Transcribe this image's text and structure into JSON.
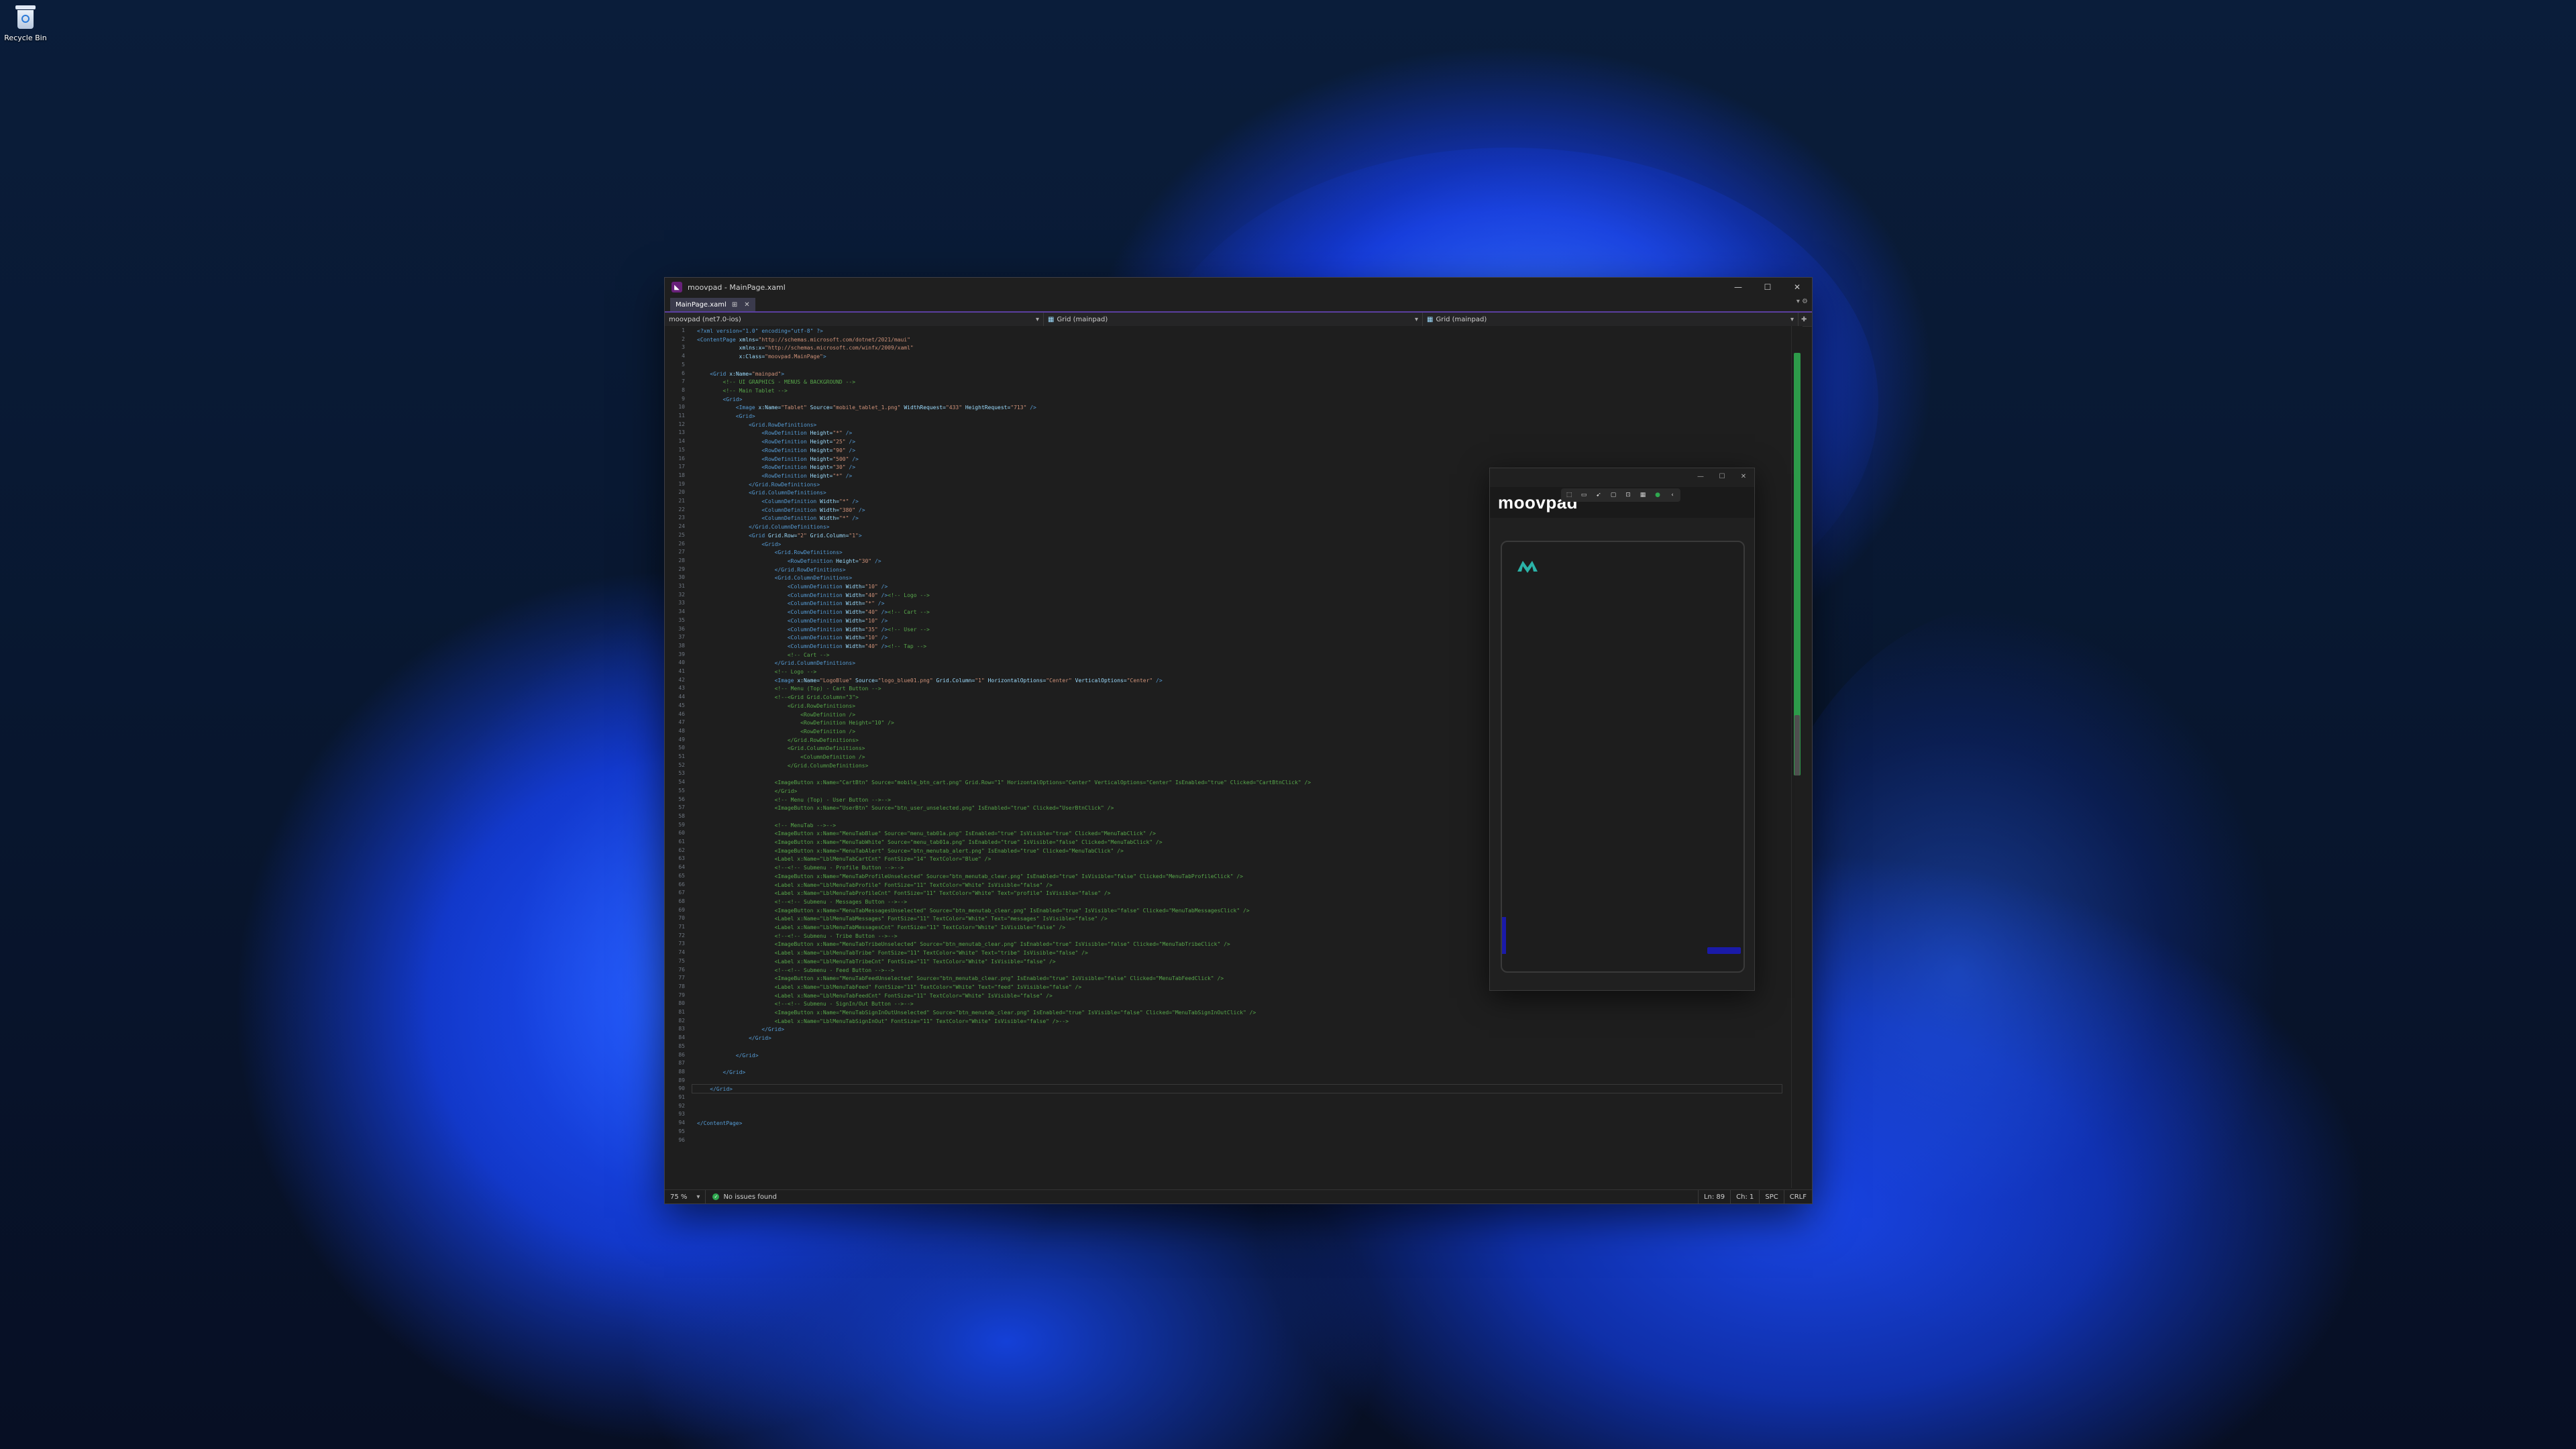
{
  "desktop": {
    "recycle_bin_label": "Recycle Bin"
  },
  "window": {
    "title": "moovpad - MainPage.xaml",
    "controls": [
      "—",
      "☐",
      "✕"
    ]
  },
  "tab": {
    "label": "MainPage.xaml",
    "pin": "⊞",
    "close": "✕"
  },
  "navbar": {
    "project": "moovpad (net7.0-ios)",
    "scope1": "Grid (mainpad)",
    "scope2": "Grid (mainpad)"
  },
  "code_lines": [
    {
      "n": "1",
      "html": "<span class='t-tag'>&lt;?xml version=\"1.0\" encoding=\"utf-8\" ?&gt;</span>"
    },
    {
      "n": "2",
      "html": "<span class='t-tag'>&lt;ContentPage</span> <span class='t-attr'>xmlns=</span><span class='t-val'>\"http://schemas.microsoft.com/dotnet/2021/maui\"</span>"
    },
    {
      "n": "3",
      "html": "             <span class='t-attr'>xmlns:x=</span><span class='t-val'>\"http://schemas.microsoft.com/winfx/2009/xaml\"</span>"
    },
    {
      "n": "4",
      "html": "             <span class='t-attr'>x:Class=</span><span class='t-val'>\"moovpad.MainPage\"</span><span class='t-tag'>&gt;</span>"
    },
    {
      "n": "5",
      "html": ""
    },
    {
      "n": "6",
      "html": "    <span class='t-tag'>&lt;Grid</span> <span class='t-attr'>x:Name=</span><span class='t-val'>\"mainpad\"</span><span class='t-tag'>&gt;</span>"
    },
    {
      "n": "7",
      "html": "        <span class='t-com'>&lt;!-- UI GRAPHICS - MENUS &amp; BACKGROUND --&gt;</span>"
    },
    {
      "n": "8",
      "html": "        <span class='t-com'>&lt;!-- Main Tablet --&gt;</span>"
    },
    {
      "n": "9",
      "html": "        <span class='t-tag'>&lt;Grid&gt;</span>"
    },
    {
      "n": "10",
      "html": "            <span class='t-tag'>&lt;Image</span> <span class='t-attr'>x:Name=</span><span class='t-val'>\"Tablet\"</span> <span class='t-attr'>Source=</span><span class='t-val'>\"mobile_tablet_1.png\"</span> <span class='t-attr'>WidthRequest=</span><span class='t-val'>\"433\"</span> <span class='t-attr'>HeightRequest=</span><span class='t-val'>\"713\"</span> <span class='t-tag'>/&gt;</span>"
    },
    {
      "n": "11",
      "html": "            <span class='t-tag'>&lt;Grid&gt;</span>"
    },
    {
      "n": "12",
      "html": "                <span class='t-tag'>&lt;Grid.RowDefinitions&gt;</span>"
    },
    {
      "n": "13",
      "html": "                    <span class='t-tag'>&lt;RowDefinition</span> <span class='t-attr'>Height=</span><span class='t-val'>\"*\"</span> <span class='t-tag'>/&gt;</span>"
    },
    {
      "n": "14",
      "html": "                    <span class='t-tag'>&lt;RowDefinition</span> <span class='t-attr'>Height=</span><span class='t-val'>\"25\"</span> <span class='t-tag'>/&gt;</span>"
    },
    {
      "n": "15",
      "html": "                    <span class='t-tag'>&lt;RowDefinition</span> <span class='t-attr'>Height=</span><span class='t-val'>\"90\"</span> <span class='t-tag'>/&gt;</span>"
    },
    {
      "n": "16",
      "html": "                    <span class='t-tag'>&lt;RowDefinition</span> <span class='t-attr'>Height=</span><span class='t-val'>\"500\"</span> <span class='t-tag'>/&gt;</span>"
    },
    {
      "n": "17",
      "html": "                    <span class='t-tag'>&lt;RowDefinition</span> <span class='t-attr'>Height=</span><span class='t-val'>\"30\"</span> <span class='t-tag'>/&gt;</span>"
    },
    {
      "n": "18",
      "html": "                    <span class='t-tag'>&lt;RowDefinition</span> <span class='t-attr'>Height=</span><span class='t-val'>\"*\"</span> <span class='t-tag'>/&gt;</span>"
    },
    {
      "n": "19",
      "html": "                <span class='t-tag'>&lt;/Grid.RowDefinitions&gt;</span>"
    },
    {
      "n": "20",
      "html": "                <span class='t-tag'>&lt;Grid.ColumnDefinitions&gt;</span>"
    },
    {
      "n": "21",
      "html": "                    <span class='t-tag'>&lt;ColumnDefinition</span> <span class='t-attr'>Width=</span><span class='t-val'>\"*\"</span> <span class='t-tag'>/&gt;</span>"
    },
    {
      "n": "22",
      "html": "                    <span class='t-tag'>&lt;ColumnDefinition</span> <span class='t-attr'>Width=</span><span class='t-val'>\"380\"</span> <span class='t-tag'>/&gt;</span>"
    },
    {
      "n": "23",
      "html": "                    <span class='t-tag'>&lt;ColumnDefinition</span> <span class='t-attr'>Width=</span><span class='t-val'>\"*\"</span> <span class='t-tag'>/&gt;</span>"
    },
    {
      "n": "24",
      "html": "                <span class='t-tag'>&lt;/Grid.ColumnDefinitions&gt;</span>"
    },
    {
      "n": "25",
      "html": "                <span class='t-tag'>&lt;Grid</span> <span class='t-attr'>Grid.Row=</span><span class='t-val'>\"2\"</span> <span class='t-attr'>Grid.Column=</span><span class='t-val'>\"1\"</span><span class='t-tag'>&gt;</span>"
    },
    {
      "n": "26",
      "html": "                    <span class='t-tag'>&lt;Grid&gt;</span>"
    },
    {
      "n": "27",
      "html": "                        <span class='t-tag'>&lt;Grid.RowDefinitions&gt;</span>"
    },
    {
      "n": "28",
      "html": "                            <span class='t-tag'>&lt;RowDefinition</span> <span class='t-attr'>Height=</span><span class='t-val'>\"30\"</span> <span class='t-tag'>/&gt;</span>"
    },
    {
      "n": "29",
      "html": "                        <span class='t-tag'>&lt;/Grid.RowDefinitions&gt;</span>"
    },
    {
      "n": "30",
      "html": "                        <span class='t-tag'>&lt;Grid.ColumnDefinitions&gt;</span>"
    },
    {
      "n": "31",
      "html": "                            <span class='t-tag'>&lt;ColumnDefinition</span> <span class='t-attr'>Width=</span><span class='t-val'>\"10\"</span> <span class='t-tag'>/&gt;</span>"
    },
    {
      "n": "32",
      "html": "                            <span class='t-tag'>&lt;ColumnDefinition</span> <span class='t-attr'>Width=</span><span class='t-val'>\"40\"</span> <span class='t-tag'>/&gt;</span><span class='t-com'>&lt;!-- Logo --&gt;</span>"
    },
    {
      "n": "33",
      "html": "                            <span class='t-tag'>&lt;ColumnDefinition</span> <span class='t-attr'>Width=</span><span class='t-val'>\"*\"</span> <span class='t-tag'>/&gt;</span>"
    },
    {
      "n": "34",
      "html": "                            <span class='t-tag'>&lt;ColumnDefinition</span> <span class='t-attr'>Width=</span><span class='t-val'>\"40\"</span> <span class='t-tag'>/&gt;</span><span class='t-com'>&lt;!-- Cart --&gt;</span>"
    },
    {
      "n": "35",
      "html": "                            <span class='t-tag'>&lt;ColumnDefinition</span> <span class='t-attr'>Width=</span><span class='t-val'>\"10\"</span> <span class='t-tag'>/&gt;</span>"
    },
    {
      "n": "36",
      "html": "                            <span class='t-tag'>&lt;ColumnDefinition</span> <span class='t-attr'>Width=</span><span class='t-val'>\"35\"</span> <span class='t-tag'>/&gt;</span><span class='t-com'>&lt;!-- User --&gt;</span>"
    },
    {
      "n": "37",
      "html": "                            <span class='t-tag'>&lt;ColumnDefinition</span> <span class='t-attr'>Width=</span><span class='t-val'>\"10\"</span> <span class='t-tag'>/&gt;</span>"
    },
    {
      "n": "38",
      "html": "                            <span class='t-tag'>&lt;ColumnDefinition</span> <span class='t-attr'>Width=</span><span class='t-val'>\"40\"</span> <span class='t-tag'>/&gt;</span><span class='t-com'>&lt;!-- Tap --&gt;</span>"
    },
    {
      "n": "39",
      "html": "                            <span class='t-com'>&lt;!-- Cart --&gt;</span>"
    },
    {
      "n": "40",
      "html": "                        <span class='t-tag'>&lt;/Grid.ColumnDefinitions&gt;</span>"
    },
    {
      "n": "41",
      "html": "                        <span class='t-com'>&lt;!-- Logo --&gt;</span>"
    },
    {
      "n": "42",
      "html": "                        <span class='t-tag'>&lt;Image</span> <span class='t-attr'>x:Name=</span><span class='t-val'>\"LogoBlue\"</span> <span class='t-attr'>Source=</span><span class='t-val'>\"logo_blue01.png\"</span> <span class='t-attr'>Grid.Column=</span><span class='t-val'>\"1\"</span> <span class='t-attr'>HorizontalOptions=</span><span class='t-val'>\"Center\"</span> <span class='t-attr'>VerticalOptions=</span><span class='t-val'>\"Center\"</span> <span class='t-tag'>/&gt;</span>"
    },
    {
      "n": "43",
      "html": "                        <span class='t-com'>&lt;!-- Menu (Top) - Cart Button --&gt;</span>"
    },
    {
      "n": "44",
      "html": "                        <span class='t-com'>&lt;!--&lt;Grid Grid.Column=\"3\"&gt;</span>"
    },
    {
      "n": "45",
      "html": "<span class='t-com'>                            &lt;Grid.RowDefinitions&gt;</span>"
    },
    {
      "n": "46",
      "html": "<span class='t-com'>                                &lt;RowDefinition /&gt;</span>"
    },
    {
      "n": "47",
      "html": "<span class='t-com'>                                &lt;RowDefinition Height=\"10\" /&gt;</span>"
    },
    {
      "n": "48",
      "html": "<span class='t-com'>                                &lt;RowDefinition /&gt;</span>"
    },
    {
      "n": "49",
      "html": "<span class='t-com'>                            &lt;/Grid.RowDefinitions&gt;</span>"
    },
    {
      "n": "50",
      "html": "<span class='t-com'>                            &lt;Grid.ColumnDefinitions&gt;</span>"
    },
    {
      "n": "51",
      "html": "<span class='t-com'>                                &lt;ColumnDefinition /&gt;</span>"
    },
    {
      "n": "52",
      "html": "<span class='t-com'>                            &lt;/Grid.ColumnDefinitions&gt;</span>"
    },
    {
      "n": "53",
      "html": ""
    },
    {
      "n": "54",
      "html": "<span class='t-com'>                        &lt;ImageButton x:Name=\"CartBtn\" Source=\"mobile_btn_cart.png\" Grid.Row=\"1\" HorizontalOptions=\"Center\" VerticalOptions=\"Center\" IsEnabled=\"true\" Clicked=\"CartBtnClick\" /&gt;</span>"
    },
    {
      "n": "55",
      "html": "<span class='t-com'>                        &lt;/Grid&gt;</span>"
    },
    {
      "n": "56",
      "html": "<span class='t-com'>                        &lt;!-- Menu (Top) - User Button --&gt;--&gt;</span>"
    },
    {
      "n": "57",
      "html": "<span class='t-com'>                        &lt;ImageButton x:Name=\"UserBtn\" Source=\"btn_user_unselected.png\" IsEnabled=\"true\" Clicked=\"UserBtnClick\" /&gt;</span>"
    },
    {
      "n": "58",
      "html": ""
    },
    {
      "n": "59",
      "html": "<span class='t-com'>                        &lt;!-- MenuTab --&gt;--&gt;</span>"
    },
    {
      "n": "60",
      "html": "<span class='t-com'>                        &lt;ImageButton x:Name=\"MenuTabBlue\" Source=\"menu_tab01a.png\" IsEnabled=\"true\" IsVisible=\"true\" Clicked=\"MenuTabClick\" /&gt;</span>"
    },
    {
      "n": "61",
      "html": "<span class='t-com'>                        &lt;ImageButton x:Name=\"MenuTabWhite\" Source=\"menu_tab01a.png\" IsEnabled=\"true\" IsVisible=\"false\" Clicked=\"MenuTabClick\" /&gt;</span>"
    },
    {
      "n": "62",
      "html": "<span class='t-com'>                        &lt;ImageButton x:Name=\"MenuTabAlert\" Source=\"btn_menutab_alert.png\" IsEnabled=\"true\" Clicked=\"MenuTabClick\" /&gt;</span>"
    },
    {
      "n": "63",
      "html": "<span class='t-com'>                        &lt;Label x:Name=\"LblMenuTabCartCnt\" FontSize=\"14\" TextColor=\"Blue\" /&gt;</span>"
    },
    {
      "n": "64",
      "html": "<span class='t-com'>                        &lt;!--&lt;!-- Submenu - Profile Button --&gt;--&gt;</span>"
    },
    {
      "n": "65",
      "html": "<span class='t-com'>                        &lt;ImageButton x:Name=\"MenuTabProfileUnselected\" Source=\"btn_menutab_clear.png\" IsEnabled=\"true\" IsVisible=\"false\" Clicked=\"MenuTabProfileClick\" /&gt;</span>"
    },
    {
      "n": "66",
      "html": "<span class='t-com'>                        &lt;Label x:Name=\"LblMenuTabProfile\" FontSize=\"11\" TextColor=\"White\" IsVisible=\"false\" /&gt;</span>"
    },
    {
      "n": "67",
      "html": "<span class='t-com'>                        &lt;Label x:Name=\"LblMenuTabProfileCnt\" FontSize=\"11\" TextColor=\"White\" Text=\"profile\" IsVisible=\"false\" /&gt;</span>"
    },
    {
      "n": "68",
      "html": "<span class='t-com'>                        &lt;!--&lt;!-- Submenu - Messages Button --&gt;--&gt;</span>"
    },
    {
      "n": "69",
      "html": "<span class='t-com'>                        &lt;ImageButton x:Name=\"MenuTabMessagesUnselected\" Source=\"btn_menutab_clear.png\" IsEnabled=\"true\" IsVisible=\"false\" Clicked=\"MenuTabMessagesClick\" /&gt;</span>"
    },
    {
      "n": "70",
      "html": "<span class='t-com'>                        &lt;Label x:Name=\"LblMenuTabMessages\" FontSize=\"11\" TextColor=\"White\" Text=\"messages\" IsVisible=\"false\" /&gt;</span>"
    },
    {
      "n": "71",
      "html": "<span class='t-com'>                        &lt;Label x:Name=\"LblMenuTabMessagesCnt\" FontSize=\"11\" TextColor=\"White\" IsVisible=\"false\" /&gt;</span>"
    },
    {
      "n": "72",
      "html": "<span class='t-com'>                        &lt;!--&lt;!-- Submenu - Tribe Button --&gt;--&gt;</span>"
    },
    {
      "n": "73",
      "html": "<span class='t-com'>                        &lt;ImageButton x:Name=\"MenuTabTribeUnselected\" Source=\"btn_menutab_clear.png\" IsEnabled=\"true\" IsVisible=\"false\" Clicked=\"MenuTabTribeClick\" /&gt;</span>"
    },
    {
      "n": "74",
      "html": "<span class='t-com'>                        &lt;Label x:Name=\"LblMenuTabTribe\" FontSize=\"11\" TextColor=\"White\" Text=\"tribe\" IsVisible=\"false\" /&gt;</span>"
    },
    {
      "n": "75",
      "html": "<span class='t-com'>                        &lt;Label x:Name=\"LblMenuTabTribeCnt\" FontSize=\"11\" TextColor=\"White\" IsVisible=\"false\" /&gt;</span>"
    },
    {
      "n": "76",
      "html": "<span class='t-com'>                        &lt;!--&lt;!-- Submenu - Feed Button --&gt;--&gt;</span>"
    },
    {
      "n": "77",
      "html": "<span class='t-com'>                        &lt;ImageButton x:Name=\"MenuTabFeedUnselected\" Source=\"btn_menutab_clear.png\" IsEnabled=\"true\" IsVisible=\"false\" Clicked=\"MenuTabFeedClick\" /&gt;</span>"
    },
    {
      "n": "78",
      "html": "<span class='t-com'>                        &lt;Label x:Name=\"LblMenuTabFeed\" FontSize=\"11\" TextColor=\"White\" Text=\"feed\" IsVisible=\"false\" /&gt;</span>"
    },
    {
      "n": "79",
      "html": "<span class='t-com'>                        &lt;Label x:Name=\"LblMenuTabFeedCnt\" FontSize=\"11\" TextColor=\"White\" IsVisible=\"false\" /&gt;</span>"
    },
    {
      "n": "80",
      "html": "<span class='t-com'>                        &lt;!--&lt;!-- Submenu - SignIn/Out Button --&gt;--&gt;</span>"
    },
    {
      "n": "81",
      "html": "<span class='t-com'>                        &lt;ImageButton x:Name=\"MenuTabSignInOutUnselected\" Source=\"btn_menutab_clear.png\" IsEnabled=\"true\" IsVisible=\"false\" Clicked=\"MenuTabSignInOutClick\" /&gt;</span>"
    },
    {
      "n": "82",
      "html": "<span class='t-com'>                        &lt;Label x:Name=\"LblMenuTabSignInOut\" FontSize=\"11\" TextColor=\"White\" IsVisible=\"false\" /&gt;--&gt;</span>"
    },
    {
      "n": "83",
      "html": "                    <span class='t-tag'>&lt;/Grid&gt;</span>"
    },
    {
      "n": "84",
      "html": "                <span class='t-tag'>&lt;/Grid&gt;</span>"
    },
    {
      "n": "85",
      "html": ""
    },
    {
      "n": "86",
      "html": "            <span class='t-tag'>&lt;/Grid&gt;</span>"
    },
    {
      "n": "87",
      "html": ""
    },
    {
      "n": "88",
      "html": "        <span class='t-tag'>&lt;/Grid&gt;</span>"
    },
    {
      "n": "89",
      "html": ""
    },
    {
      "n": "90",
      "html": "    <span class='t-tag'>&lt;/Grid&gt;</span>"
    },
    {
      "n": "91",
      "html": ""
    },
    {
      "n": "92",
      "html": ""
    },
    {
      "n": "93",
      "html": ""
    },
    {
      "n": "94",
      "html": "<span class='t-tag'>&lt;/ContentPage&gt;</span>"
    },
    {
      "n": "95",
      "html": ""
    },
    {
      "n": "96",
      "html": ""
    }
  ],
  "status": {
    "zoom": "75 %",
    "issues": "No issues found",
    "line": "Ln: 89",
    "col": "Ch: 1",
    "spaces": "SPC",
    "eol": "CRLF"
  },
  "app_preview": {
    "brand": "moovpad",
    "toolbar_icons": [
      "select-icon",
      "camera-icon",
      "pointer-icon",
      "frame-icon",
      "layout-icon",
      "binding-icon",
      "hot-reload-icon",
      "chevron-icon"
    ]
  },
  "colors": {
    "accent_purple": "#5b3fa0",
    "ok_green": "#2fa84f",
    "logo_teal": "#2bb3a8",
    "accent_blue": "#1a1aa8"
  }
}
